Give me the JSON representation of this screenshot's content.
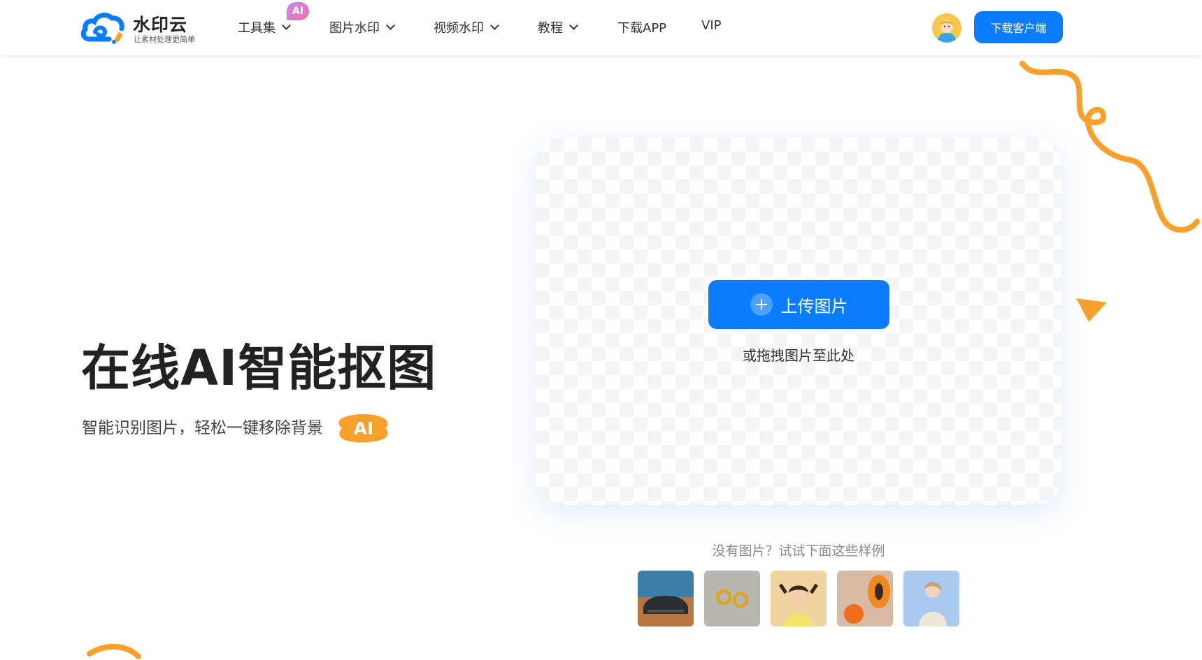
{
  "header": {
    "logo": {
      "name": "水印云",
      "slogan": "让素材处理更简单"
    },
    "nav": [
      {
        "label": "工具集",
        "has_dropdown": true,
        "badge": "AI"
      },
      {
        "label": "图片水印",
        "has_dropdown": true
      },
      {
        "label": "视频水印",
        "has_dropdown": true
      },
      {
        "label": "教程",
        "has_dropdown": true
      },
      {
        "label": "下载APP",
        "has_dropdown": false
      },
      {
        "label": "VIP",
        "has_dropdown": false
      }
    ],
    "download_button": "下载客户端"
  },
  "hero": {
    "title": "在线AI智能抠图",
    "subtitle": "智能识别图片，轻松一键移除背景",
    "ai_tag": "AI"
  },
  "upload": {
    "button_label": "上传图片",
    "hint": "或拖拽图片至此处"
  },
  "samples": {
    "title": "没有图片？试试下面这些样例",
    "items": [
      "sample-car",
      "sample-earrings",
      "sample-child",
      "sample-papaya",
      "sample-woman"
    ]
  },
  "colors": {
    "primary": "#0a7cff",
    "accent": "#f7a12b",
    "title": "#222222"
  }
}
